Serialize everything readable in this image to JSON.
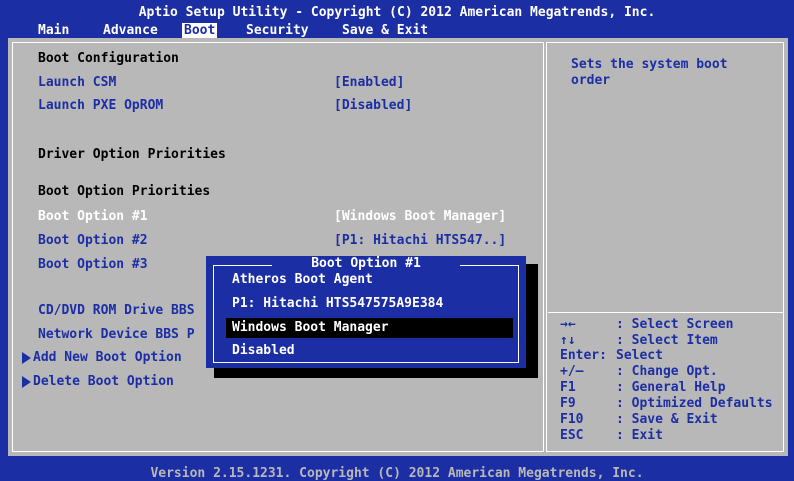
{
  "header": {
    "title": "Aptio Setup Utility - Copyright (C) 2012 American Megatrends, Inc.",
    "tabs": [
      {
        "label": "Main"
      },
      {
        "label": "Advance"
      },
      {
        "label": "Boot"
      },
      {
        "label": "Security"
      },
      {
        "label": "Save & Exit"
      }
    ]
  },
  "left": {
    "boot_configuration": "Boot Configuration",
    "launch_csm_label": "Launch CSM",
    "launch_csm_value": "[Enabled]",
    "launch_pxe_label": "Launch PXE OpROM",
    "launch_pxe_value": "[Disabled]",
    "driver_option_priorities": "Driver Option Priorities",
    "boot_option_priorities": "Boot Option Priorities",
    "boot_option_1_label": "Boot Option #1",
    "boot_option_1_value": "[Windows Boot Manager]",
    "boot_option_2_label": "Boot Option #2",
    "boot_option_2_value": "[P1: Hitachi HTS547..]",
    "boot_option_3_label": "Boot Option #3",
    "cd_dvd_label": "CD/DVD ROM Drive BBS",
    "network_label": "Network Device BBS P",
    "add_new_boot_option": "Add New Boot Option",
    "delete_boot_option": "Delete Boot Option"
  },
  "help": {
    "line1": "Sets the system boot",
    "line2": "order"
  },
  "keys": [
    {
      "key": "→←",
      "desc": ": Select Screen"
    },
    {
      "key": "↑↓",
      "desc": ": Select Item"
    },
    {
      "key": "Enter:",
      "desc": "Select"
    },
    {
      "key": "+/—",
      "desc": ": Change Opt."
    },
    {
      "key": "F1",
      "desc": ": General Help"
    },
    {
      "key": "F9",
      "desc": ": Optimized Defaults"
    },
    {
      "key": "F10",
      "desc": ": Save & Exit"
    },
    {
      "key": "ESC",
      "desc": ": Exit"
    }
  ],
  "popup": {
    "title": "Boot Option #1",
    "items": [
      {
        "label": "Atheros Boot Agent"
      },
      {
        "label": "P1: Hitachi HTS547575A9E384"
      },
      {
        "label": "Windows Boot Manager"
      },
      {
        "label": "Disabled"
      }
    ]
  },
  "footer": "Version 2.15.1231. Copyright (C) 2012 American Megatrends, Inc.",
  "colors": {
    "background": "#1c2ea4",
    "panel": "#b8b8b8",
    "text_blue": "#1c2ea4",
    "highlight": "#ffffff",
    "selection": "#000000"
  }
}
